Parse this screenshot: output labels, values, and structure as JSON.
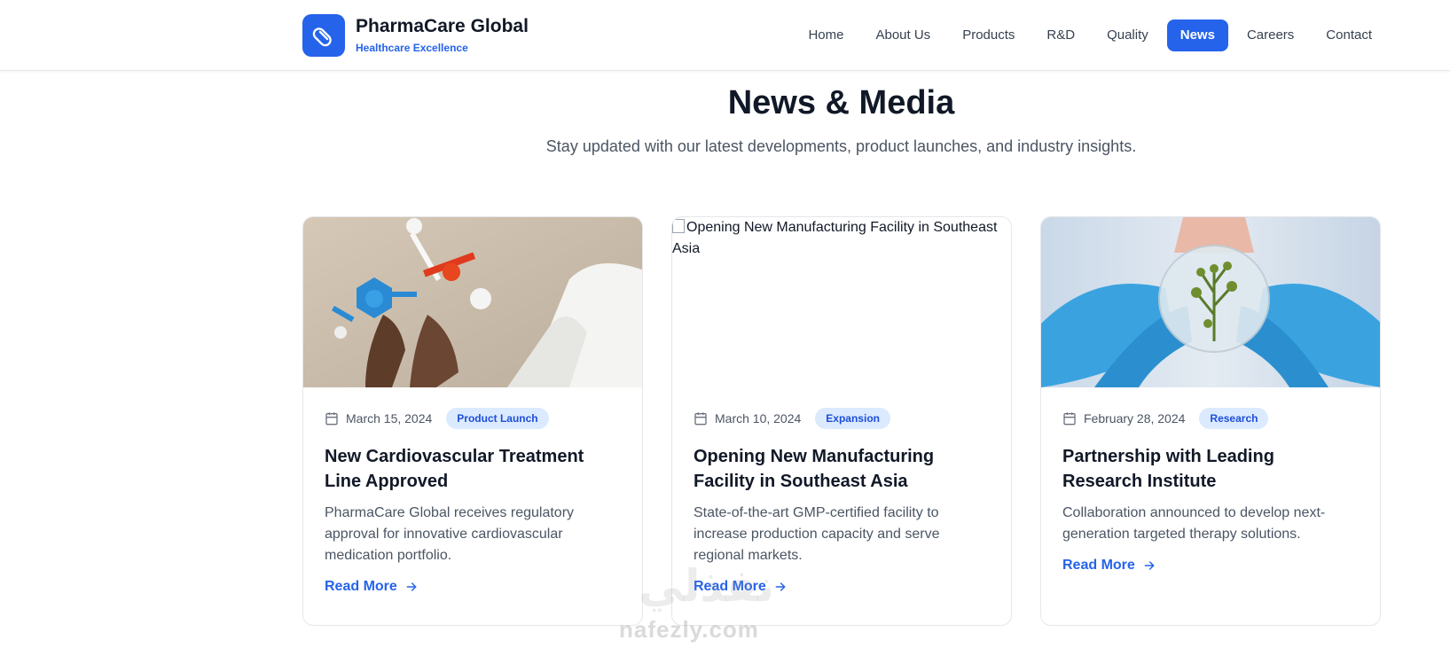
{
  "brand": {
    "name": "PharmaCare Global",
    "tagline": "Healthcare Excellence"
  },
  "nav": {
    "items": [
      {
        "label": "Home"
      },
      {
        "label": "About Us"
      },
      {
        "label": "Products"
      },
      {
        "label": "R&D"
      },
      {
        "label": "Quality"
      },
      {
        "label": "News",
        "active": true
      },
      {
        "label": "Careers"
      },
      {
        "label": "Contact"
      }
    ]
  },
  "hero": {
    "title": "News & Media",
    "subtitle": "Stay updated with our latest developments, product launches, and industry insights."
  },
  "cards": [
    {
      "date": "March 15, 2024",
      "badge": "Product Launch",
      "title": "New Cardiovascular Treatment Line Approved",
      "description": "PharmaCare Global receives regulatory approval for innovative cardiovascular medication portfolio.",
      "read_more": "Read More"
    },
    {
      "image_alt": "Opening New Manufacturing Facility in Southeast Asia",
      "date": "March 10, 2024",
      "badge": "Expansion",
      "title": "Opening New Manufacturing Facility in Southeast Asia",
      "description": "State-of-the-art GMP-certified facility to increase production capacity and serve regional markets.",
      "read_more": "Read More"
    },
    {
      "date": "February 28, 2024",
      "badge": "Research",
      "title": "Partnership with Leading Research Institute",
      "description": "Collaboration announced to develop next-generation targeted therapy solutions.",
      "read_more": "Read More"
    }
  ],
  "watermark": {
    "text": "nafezly.com",
    "arabic": "نفذلي"
  },
  "colors": {
    "accent": "#2563eb",
    "badge_bg": "#dbeafe",
    "badge_text": "#1d4ed8",
    "text_primary": "#111827",
    "text_secondary": "#4b5563"
  },
  "icons": {
    "logo": "pill-icon",
    "date": "calendar-icon",
    "read_more": "arrow-right-icon"
  }
}
